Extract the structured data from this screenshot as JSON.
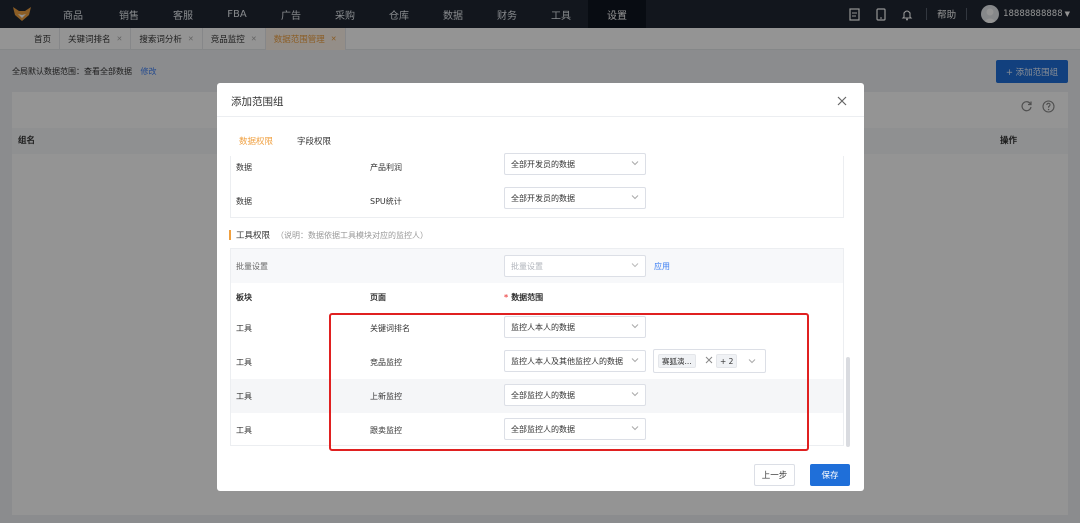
{
  "nav": {
    "items": [
      "商品",
      "销售",
      "客服",
      "FBA",
      "广告",
      "采购",
      "仓库",
      "数据",
      "财务",
      "工具",
      "设置"
    ],
    "active_index": 10,
    "help": "帮助",
    "username": "18888888888",
    "logo_icon": "fox-logo-icon",
    "icons": [
      "document-icon",
      "tablet-icon",
      "bell-icon"
    ]
  },
  "tabs": {
    "items": [
      "首页",
      "关键词排名",
      "搜索词分析",
      "竞品监控",
      "数据范围管理"
    ],
    "active_index": 4
  },
  "page": {
    "scope_label": "全局默认数据范围：查看全部数据",
    "scope_edit": "修改",
    "add_button": "+ 添加范围组",
    "col_name": "组名",
    "col_action": "操作"
  },
  "modal": {
    "title": "添加范围组",
    "perm_tabs": [
      "数据权限",
      "字段权限"
    ],
    "active_perm_tab": 0,
    "data_rows": [
      {
        "board": "数据",
        "page": "产品利润",
        "scope": "全部开发员的数据"
      },
      {
        "board": "数据",
        "page": "SPU统计",
        "scope": "全部开发员的数据"
      }
    ],
    "tool_section": {
      "title": "工具权限",
      "note": "（说明：数据依据工具模块对应的监控人）"
    },
    "batch": {
      "label": "批量设置",
      "placeholder": "批量设置",
      "apply": "应用"
    },
    "headers": {
      "board": "板块",
      "page": "页面",
      "scope": "数据范围"
    },
    "tool_rows": [
      {
        "board": "工具",
        "page": "关键词排名",
        "scope": "监控人本人的数据"
      },
      {
        "board": "工具",
        "page": "竞品监控",
        "scope": "监控人本人及其他监控人的数据"
      },
      {
        "board": "工具",
        "page": "上新监控",
        "scope": "全部监控人的数据"
      },
      {
        "board": "工具",
        "page": "跟卖监控",
        "scope": "全部监控人的数据"
      }
    ],
    "extra_tags": {
      "tag": "赛狐演...",
      "more": "+ 2"
    },
    "buttons": {
      "prev": "上一步",
      "save": "保存"
    }
  },
  "colors": {
    "nav_bg": "#1f2733",
    "accent_orange": "#f0a040",
    "primary_blue": "#1f6fd9",
    "highlight_red": "#e02020"
  }
}
